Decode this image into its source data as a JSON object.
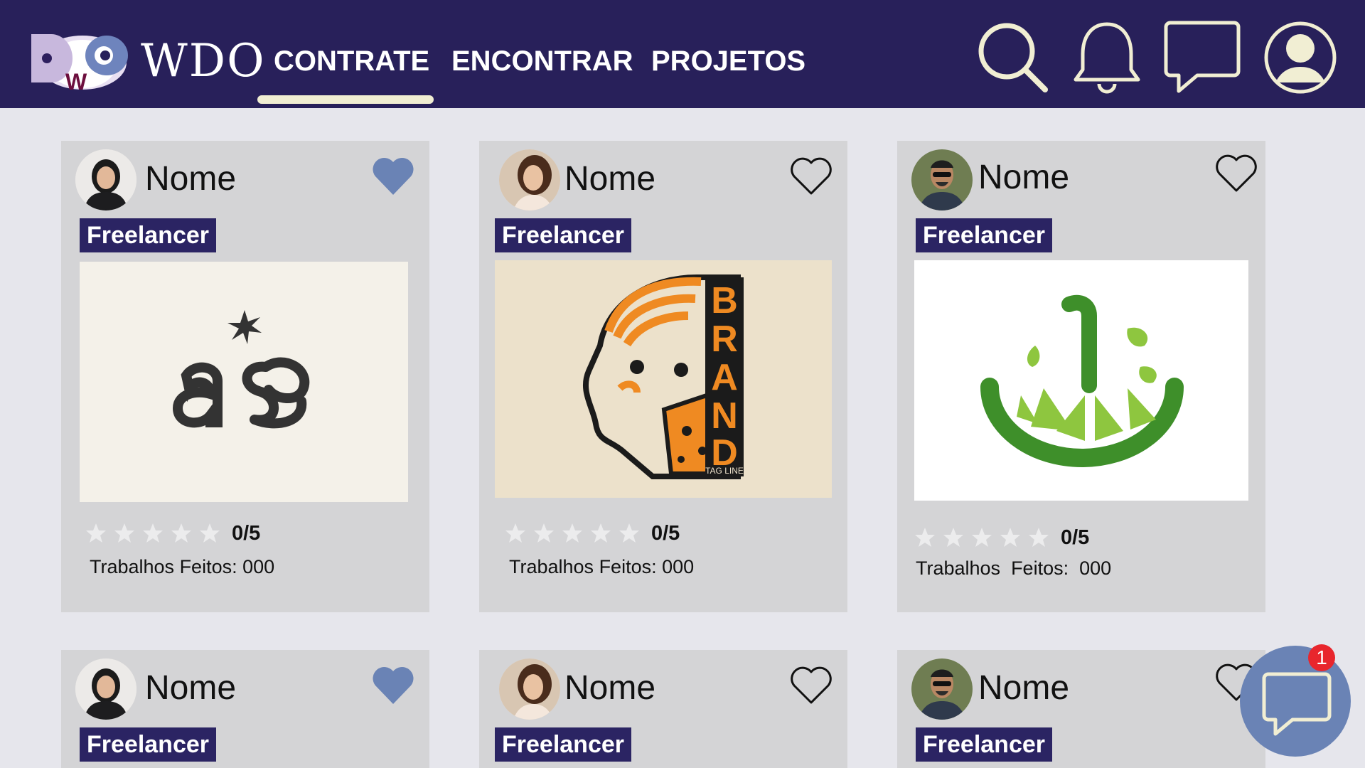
{
  "header": {
    "brand": "WDO",
    "logo_letters": [
      "D",
      "W",
      "O"
    ],
    "nav": [
      {
        "label": "CONTRATE",
        "active": true
      },
      {
        "label": "ENCONTRAR",
        "active": false
      },
      {
        "label": "PROJETOS",
        "active": false
      }
    ],
    "icons": [
      "search-icon",
      "bell-icon",
      "chat-icon",
      "user-profile-icon"
    ]
  },
  "cards": [
    {
      "name": "Nome",
      "role": "Freelancer",
      "favorited": true,
      "rating": "0/5",
      "rating_value": 0,
      "rating_max": 5,
      "jobs": "Trabalhos Feitos: 000",
      "artwork": "as monogram logo"
    },
    {
      "name": "Nome",
      "role": "Freelancer",
      "favorited": false,
      "rating": "0/5",
      "rating_value": 0,
      "rating_max": 5,
      "jobs": "Trabalhos Feitos: 000",
      "artwork": "BRAND tag line illustration"
    },
    {
      "name": "Nome",
      "role": "Freelancer",
      "favorited": false,
      "rating": "0/5",
      "rating_value": 0,
      "rating_max": 5,
      "jobs": "Trabalhos  Feitos:  000",
      "artwork": "lime juice logo"
    },
    {
      "name": "Nome",
      "role": "Freelancer",
      "favorited": true
    },
    {
      "name": "Nome",
      "role": "Freelancer",
      "favorited": false
    },
    {
      "name": "Nome",
      "role": "Freelancer",
      "favorited": false
    }
  ],
  "artwork_text": {
    "brand_letters": [
      "B",
      "R",
      "A",
      "N",
      "D"
    ],
    "tagline": "TAG LINE"
  },
  "chat_fab": {
    "badge": "1"
  },
  "colors": {
    "navy": "#28205a",
    "card": "#d4d4d6",
    "badge": "#2b2463",
    "heart_filled": "#6a83b5",
    "accent_underline": "#f1eed3",
    "notification": "#e8262d"
  }
}
